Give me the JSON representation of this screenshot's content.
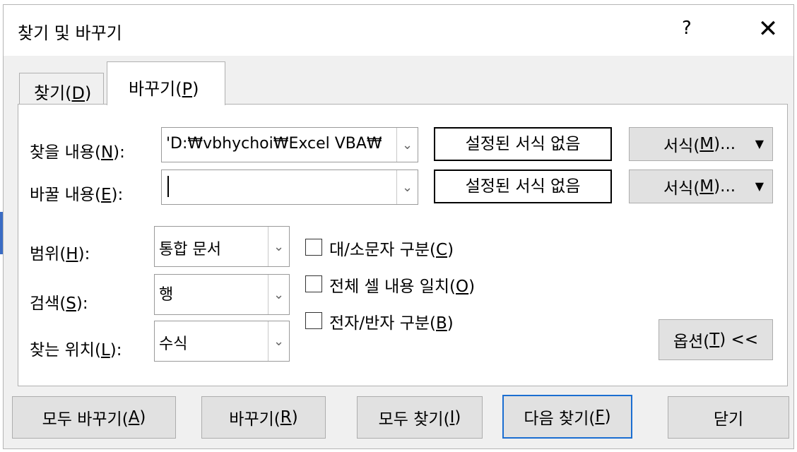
{
  "dialog": {
    "title": "찾기 및 바꾸기",
    "help": "?",
    "close": "✕"
  },
  "tabs": [
    {
      "pre": "찾기(",
      "key": "D",
      "post": ")"
    },
    {
      "pre": "바꾸기(",
      "key": "P",
      "post": ")"
    }
  ],
  "find_what": {
    "pre": "찾을 내용(",
    "key": "N",
    "post": "):",
    "value": "'D:₩vbhychoi₩Excel VBA₩",
    "format": "설정된 서식 없음"
  },
  "replace_with": {
    "pre": "바꿀 내용(",
    "key": "E",
    "post": "):",
    "value": "",
    "format": "설정된 서식 없음"
  },
  "format_button": {
    "pre": "서식(",
    "key": "M",
    "post": ")..."
  },
  "within": {
    "pre": "범위(",
    "key": "H",
    "post": "):",
    "value": "통합 문서"
  },
  "search": {
    "pre": "검색(",
    "key": "S",
    "post": "):",
    "value": "행"
  },
  "look_in": {
    "pre": "찾는 위치(",
    "key": "L",
    "post": "):",
    "value": "수식"
  },
  "options": [
    {
      "pre": "대/소문자 구분(",
      "key": "C",
      "post": ")",
      "checked": false
    },
    {
      "pre": "전체 셀 내용 일치(",
      "key": "O",
      "post": ")",
      "checked": false
    },
    {
      "pre": "전자/반자 구분(",
      "key": "B",
      "post": ")",
      "checked": false
    }
  ],
  "options_button": {
    "pre": "옵션(",
    "key": "T",
    "post": ") <<"
  },
  "buttons": [
    {
      "pre": "모두 바꾸기(",
      "key": "A",
      "post": ")"
    },
    {
      "pre": "바꾸기(",
      "key": "R",
      "post": ")"
    },
    {
      "pre": "모두 찾기(",
      "key": "I",
      "post": ")"
    },
    {
      "pre": "다음 찾기(",
      "key": "F",
      "post": ")"
    },
    {
      "pre": "닫기",
      "key": "",
      "post": ""
    }
  ]
}
